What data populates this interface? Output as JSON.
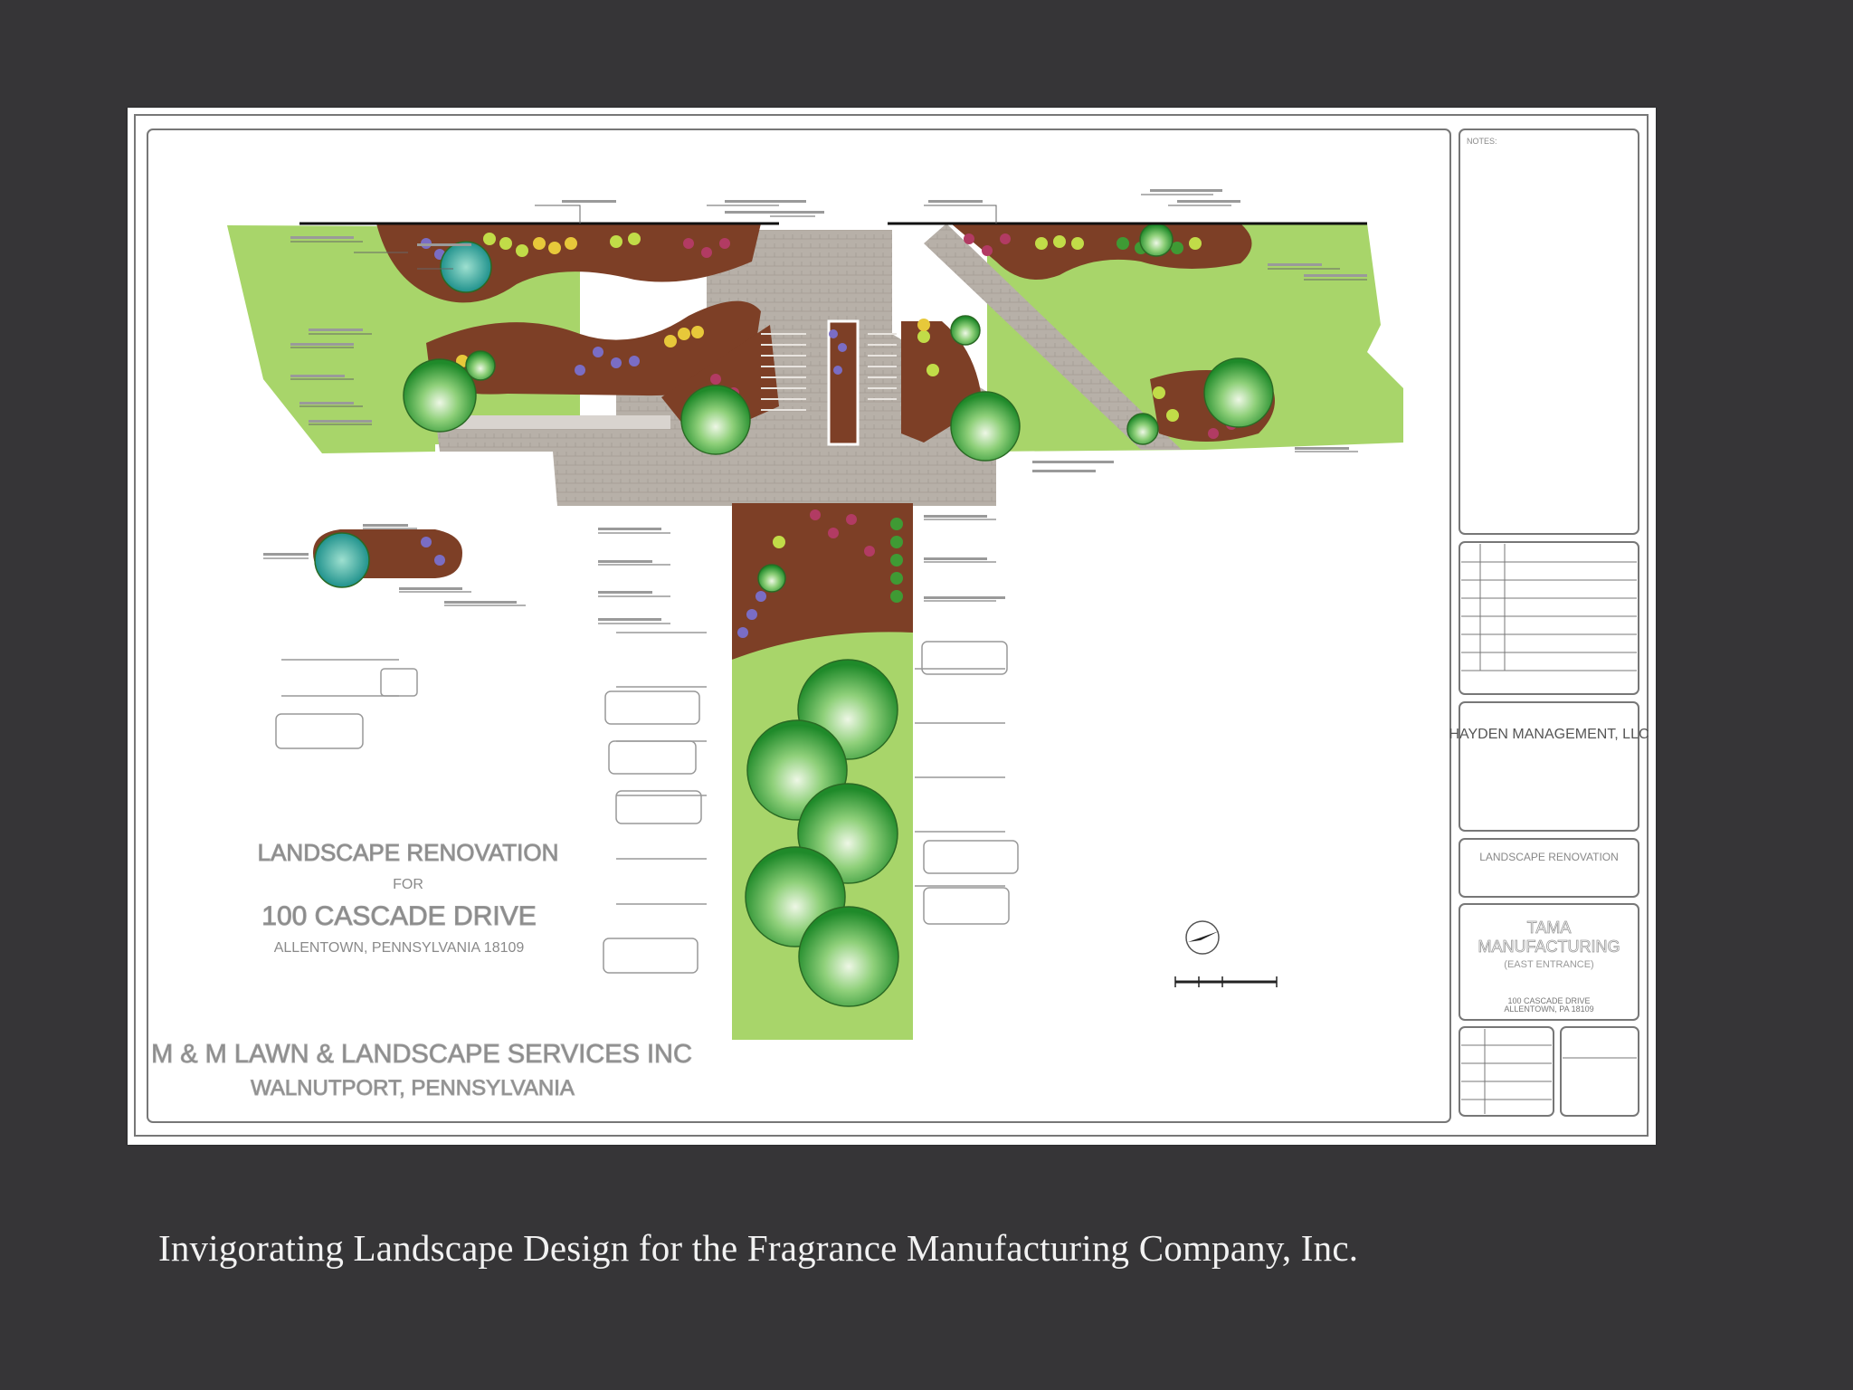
{
  "caption": "Invigorating Landscape Design for the Fragrance Manufacturing Company, Inc.",
  "plan": {
    "title_line1": "LANDSCAPE RENOVATION",
    "title_line2": "FOR",
    "title_line3": "100 CASCADE DRIVE",
    "title_line4": "ALLENTOWN, PENNSYLVANIA 18109",
    "contractor_line1": "M & M LAWN & LANDSCAPE SERVICES INC",
    "contractor_line2": "WALNUTPORT, PENNSYLVANIA"
  },
  "title_block": {
    "notes_label": "NOTES:",
    "client": "HAYDEN MANAGEMENT, LLC",
    "project": "LANDSCAPE RENOVATION",
    "site_line1": "TAMA",
    "site_line2": "MANUFACTURING",
    "site_line3": "(EAST ENTRANCE)",
    "site_address_line1": "100 CASCADE DRIVE",
    "site_address_line2": "ALLENTOWN, PA 18109"
  },
  "colors": {
    "background": "#363537",
    "lawn": "#a8d56a",
    "paving": "#b3aca5",
    "mulch": "#8a4a2c",
    "tree": "#3fa93a",
    "caption_text": "#f2f2f2"
  },
  "icons": [
    "north-arrow-icon",
    "scale-bar-icon"
  ]
}
